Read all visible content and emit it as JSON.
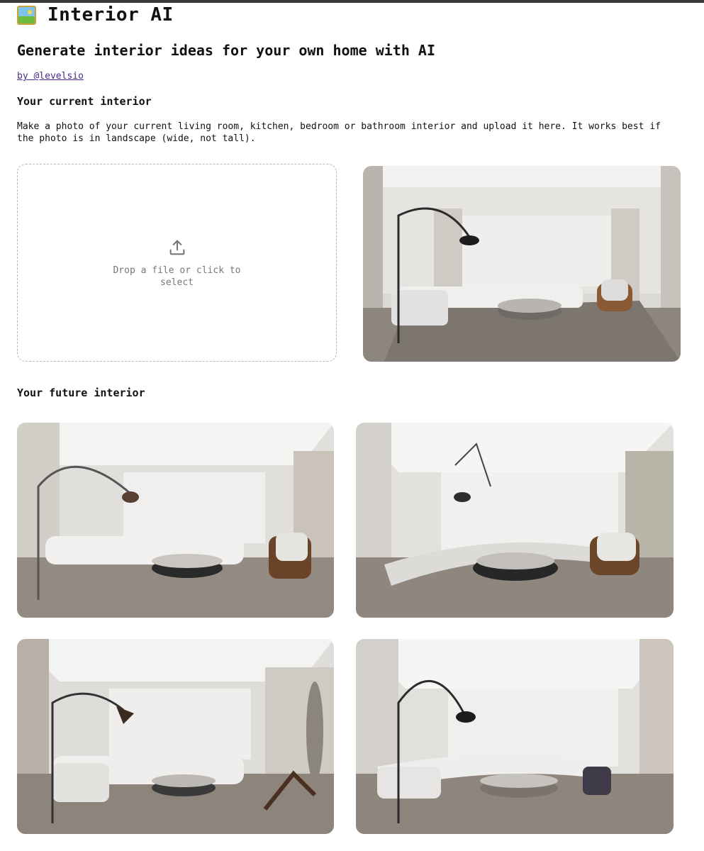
{
  "header": {
    "app_icon": "framed-picture-icon",
    "title": "Interior AI",
    "headline": "Generate interior ideas for your own home with AI",
    "byline": "by @levelsio"
  },
  "current": {
    "section_title": "Your current interior",
    "description": "Make a photo of your current living room, kitchen, bedroom or bathroom interior and upload it here. It works best if the photo is in landscape (wide, not tall).",
    "dropzone_icon": "upload-icon",
    "dropzone_text": "Drop a file or click to select"
  },
  "future": {
    "section_title": "Your future interior"
  },
  "colors": {
    "link": "#4a2a8a",
    "dropzone_border": "#b8b8b8"
  }
}
